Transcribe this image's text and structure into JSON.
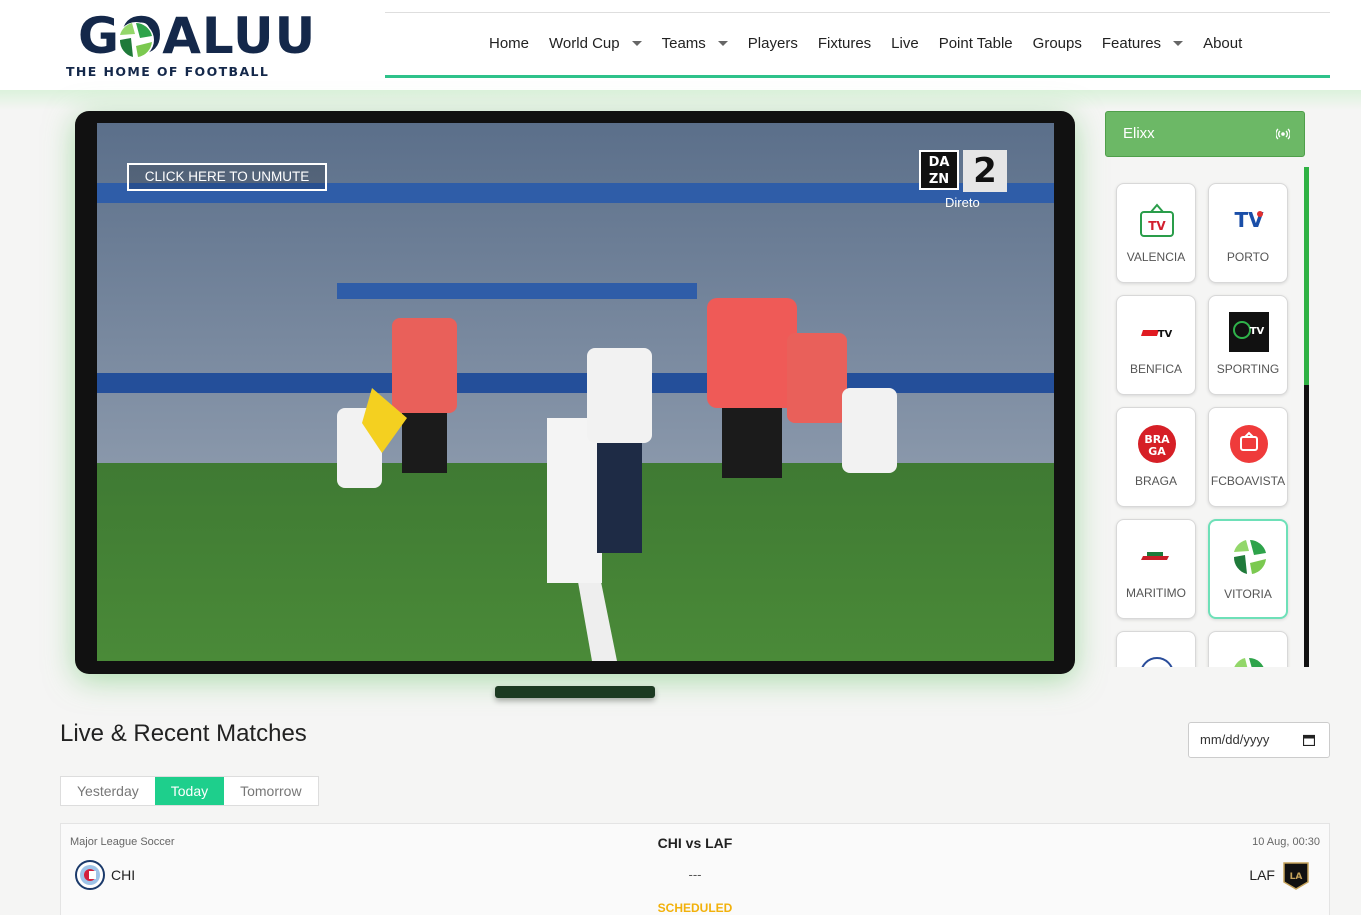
{
  "brand": {
    "logo_word": "GOALUU",
    "tagline": "THE HOME OF FOOTBALL"
  },
  "nav": {
    "items": [
      {
        "label": "Home",
        "dropdown": false
      },
      {
        "label": "World Cup",
        "dropdown": true
      },
      {
        "label": "Teams",
        "dropdown": true
      },
      {
        "label": "Players",
        "dropdown": false
      },
      {
        "label": "Fixtures",
        "dropdown": false
      },
      {
        "label": "Live",
        "dropdown": false
      },
      {
        "label": "Point Table",
        "dropdown": false
      },
      {
        "label": "Groups",
        "dropdown": false
      },
      {
        "label": "Features",
        "dropdown": true
      },
      {
        "label": "About",
        "dropdown": false
      }
    ],
    "accent_color": "#2ec28a"
  },
  "player": {
    "unmute_label": "CLICK HERE TO UNMUTE",
    "broadcaster": "DAZN",
    "broadcaster_channel": "2",
    "broadcaster_status": "Direto",
    "icon": "live-broadcast-icon"
  },
  "sidebar": {
    "provider": "Elixx",
    "provider_icon": "live-signal-icon",
    "channels": [
      {
        "label": "VALENCIA",
        "icon": "valencia-tv-logo",
        "active": false
      },
      {
        "label": "PORTO",
        "icon": "porto-tv-logo",
        "active": false
      },
      {
        "label": "BENFICA",
        "icon": "benfica-tv-logo",
        "active": false
      },
      {
        "label": "SPORTING",
        "icon": "sporting-tv-logo",
        "active": false
      },
      {
        "label": "BRAGA",
        "icon": "braga-tv-logo",
        "active": false
      },
      {
        "label": "FCBOAVISTA",
        "icon": "boavista-tv-logo",
        "active": false
      },
      {
        "label": "MARITIMO",
        "icon": "maritimo-tv-logo",
        "active": false
      },
      {
        "label": "VITORIA",
        "icon": "vitoria-tv-logo",
        "active": true
      },
      {
        "label": "",
        "icon": "channel-logo",
        "active": false
      },
      {
        "label": "",
        "icon": "channel-logo",
        "active": false
      }
    ]
  },
  "matches": {
    "title": "Live & Recent Matches",
    "date_placeholder": "mm/dd/yyyy",
    "tabs": [
      {
        "label": "Yesterday",
        "active": false
      },
      {
        "label": "Today",
        "active": true
      },
      {
        "label": "Tomorrow",
        "active": false
      }
    ],
    "list": [
      {
        "league": "Major League Soccer",
        "title": "CHI vs LAF",
        "time": "10 Aug, 00:30",
        "home": "CHI",
        "away": "LAF",
        "score": "---",
        "status": "SCHEDULED"
      }
    ]
  }
}
